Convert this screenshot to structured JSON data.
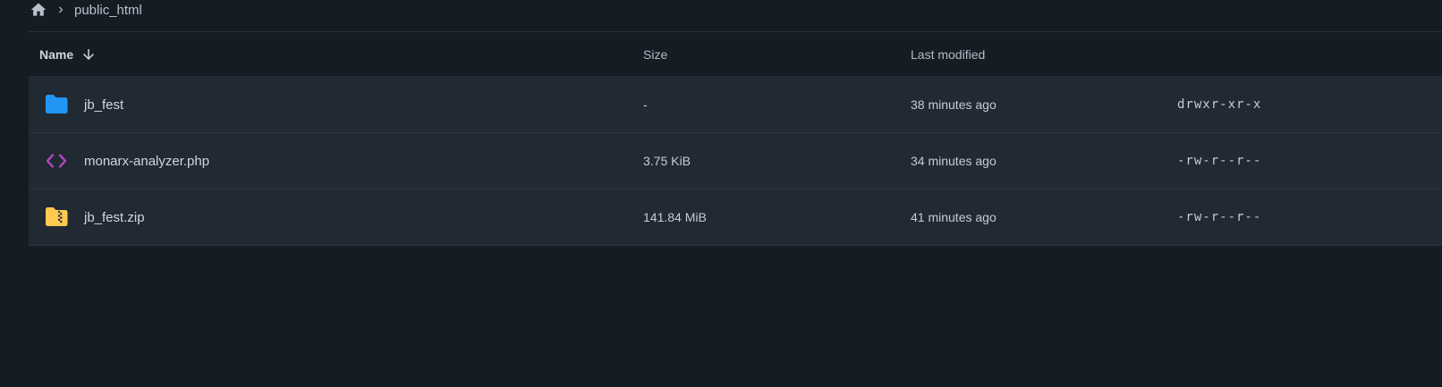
{
  "breadcrumb": {
    "home_icon": "home-icon",
    "separator_icon": "chevron-right-icon",
    "current": "public_html"
  },
  "table": {
    "headers": {
      "name": "Name",
      "size": "Size",
      "modified": "Last modified",
      "sort_icon": "arrow-down-icon"
    },
    "rows": [
      {
        "icon": "folder-icon",
        "name": "jb_fest",
        "size": "-",
        "modified": "38 minutes ago",
        "permissions": "drwxr-xr-x"
      },
      {
        "icon": "code-icon",
        "name": "monarx-analyzer.php",
        "size": "3.75 KiB",
        "modified": "34 minutes ago",
        "permissions": "-rw-r--r--"
      },
      {
        "icon": "zip-folder-icon",
        "name": "jb_fest.zip",
        "size": "141.84 MiB",
        "modified": "41 minutes ago",
        "permissions": "-rw-r--r--"
      }
    ]
  },
  "colors": {
    "background": "#161c24",
    "row_background": "#212932",
    "folder_blue": "#2196f3",
    "code_purple": "#ab47bc",
    "zip_yellow": "#ffca4f"
  }
}
